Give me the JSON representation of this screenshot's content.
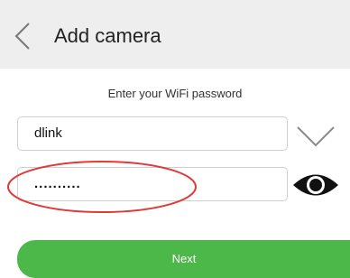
{
  "header": {
    "title": "Add camera",
    "back_icon": "chevron-left-icon",
    "background": "#eeeeee"
  },
  "form": {
    "instruction": "Enter your WiFi password",
    "wifi_name": "dlink",
    "password_masked": "..........",
    "dropdown_icon": "chevron-down-icon",
    "show_password_icon": "eye-icon"
  },
  "annotation": {
    "color": "#e03a3a"
  },
  "actions": {
    "next_label": "Next",
    "next_color": "#4cb84a"
  }
}
